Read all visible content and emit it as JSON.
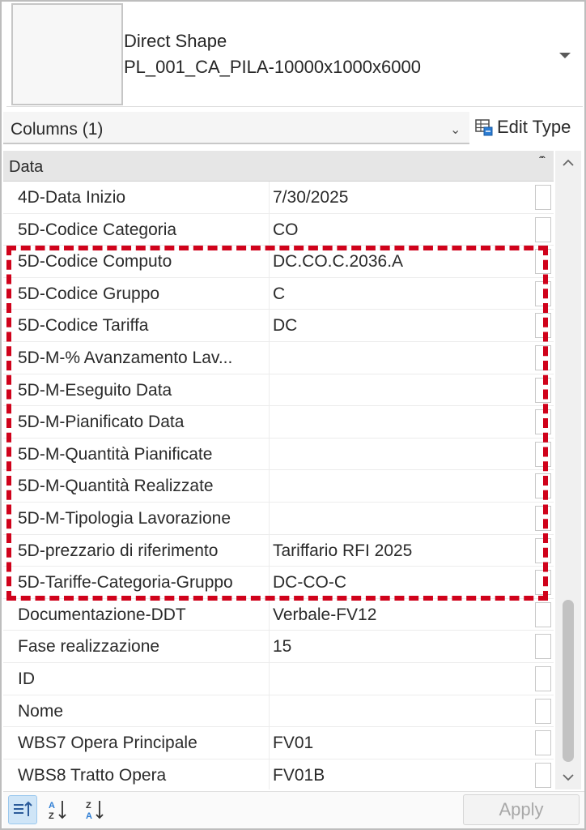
{
  "type_selector": {
    "family": "Direct Shape",
    "type": "PL_001_CA_PILA-10000x1000x6000"
  },
  "filter": {
    "label": "Columns (1)",
    "edit_type_label": "Edit Type"
  },
  "group": {
    "label": "Data"
  },
  "properties": [
    {
      "name": "4D-Data Inizio",
      "value": "7/30/2025"
    },
    {
      "name": "5D-Codice Categoria",
      "value": "CO"
    },
    {
      "name": "5D-Codice Computo",
      "value": "DC.CO.C.2036.A"
    },
    {
      "name": "5D-Codice Gruppo",
      "value": "C"
    },
    {
      "name": "5D-Codice Tariffa",
      "value": "DC"
    },
    {
      "name": "5D-M-% Avanzamento Lav...",
      "value": ""
    },
    {
      "name": "5D-M-Eseguito Data",
      "value": ""
    },
    {
      "name": "5D-M-Pianificato Data",
      "value": ""
    },
    {
      "name": "5D-M-Quantità Pianificate",
      "value": ""
    },
    {
      "name": "5D-M-Quantità Realizzate",
      "value": ""
    },
    {
      "name": "5D-M-Tipologia Lavorazione",
      "value": ""
    },
    {
      "name": "5D-prezzario di riferimento",
      "value": "Tariffario RFI 2025"
    },
    {
      "name": "5D-Tariffe-Categoria-Gruppo",
      "value": "DC-CO-C"
    },
    {
      "name": "Documentazione-DDT",
      "value": "Verbale-FV12"
    },
    {
      "name": "Fase realizzazione",
      "value": "15"
    },
    {
      "name": "ID",
      "value": ""
    },
    {
      "name": "Nome",
      "value": ""
    },
    {
      "name": "WBS7 Opera Principale",
      "value": "FV01"
    },
    {
      "name": "WBS8 Tratto Opera",
      "value": "FV01B"
    }
  ],
  "toolbar": {
    "apply_label": "Apply"
  },
  "colors": {
    "highlight": "#d0021b",
    "selected_sort": "#cfe5f7"
  },
  "icons": [
    "edit-type-icon",
    "categorized-sort-icon",
    "sort-az-icon",
    "sort-za-icon",
    "chevron-down-icon",
    "scroll-up-icon",
    "scroll-down-icon"
  ]
}
